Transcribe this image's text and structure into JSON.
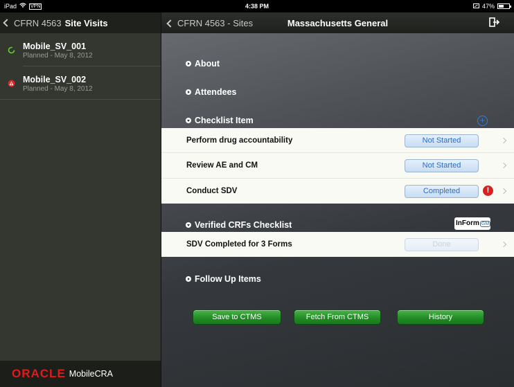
{
  "status_bar": {
    "device": "iPad",
    "carrier": "VPN",
    "time": "4:38 PM",
    "battery": "47%",
    "battery_level": 0.47
  },
  "left": {
    "back_label": "CFRN 4563",
    "title": "Site Visits",
    "visits": [
      {
        "name": "Mobile_SV_001",
        "sub": "Planned - May 8, 2012",
        "icon": "sync-icon"
      },
      {
        "name": "Mobile_SV_002",
        "sub": "Planned - May 8, 2012",
        "icon": "alert-icon"
      }
    ],
    "footer": {
      "brand": "ORACLE",
      "product": "MobileCRA"
    }
  },
  "right": {
    "back_label": "CFRN 4563 - Sites",
    "title": "Massachusetts General",
    "sections": {
      "about": "About",
      "attendees": "Attendees",
      "checklist": "Checklist Item",
      "verified": "Verified CRFs Checklist",
      "followup": "Follow Up Items"
    },
    "checklist_items": [
      {
        "label": "Perform drug accountability",
        "status": "Not Started"
      },
      {
        "label": "Review AE and CM",
        "status": "Not Started"
      },
      {
        "label": "Conduct SDV",
        "status": "Completed",
        "warning": "!"
      }
    ],
    "verified_items": [
      {
        "label": "SDV Completed for 3 Forms",
        "status": "Done"
      }
    ],
    "inform_logo": {
      "main": "InForm",
      "sub": "GM"
    },
    "actions": {
      "save": "Save to CTMS",
      "fetch": "Fetch From CTMS",
      "history": "History"
    }
  }
}
